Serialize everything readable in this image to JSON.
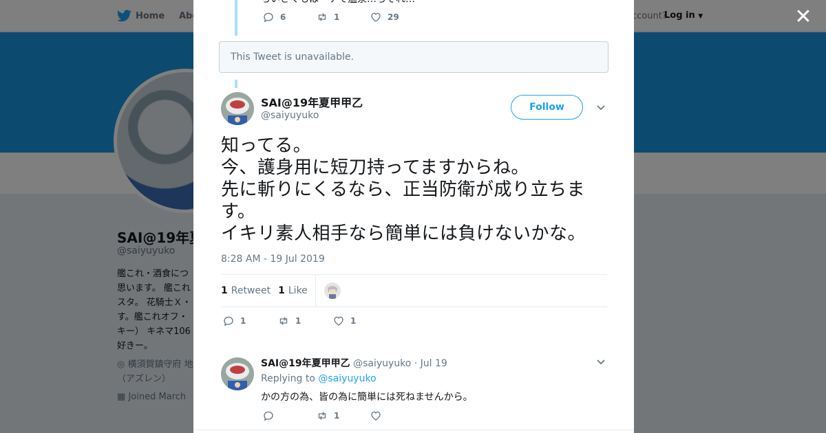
{
  "nav": {
    "home_label": "Home",
    "about_label": "Abo",
    "account_prompt": "ccount?",
    "login_label": "Log in"
  },
  "profile": {
    "name": "SAI@19年夏",
    "handle": "@saiyuyuko",
    "bio": "艦これ・酒食につ 思います。 艦これ スタ。 花騎士Ｘ・ す。艦これオフ・ キー） キネマ106 好きー。",
    "location": "横須賀鎮守府 地（アズレン）",
    "joined": "Joined March"
  },
  "modal": {
    "top_tweet": {
      "snippet_text": "ちいさくもはーケて温泉…ちそれ…",
      "reply_count": "6",
      "retweet_count": "1",
      "like_count": "29"
    },
    "unavailable_notice": "This Tweet is unavailable.",
    "main_tweet": {
      "name": "SAI@19年夏甲甲乙",
      "handle": "@saiyuyuko",
      "follow_label": "Follow",
      "lines": [
        "知ってる。",
        "今、護身用に短刀持ってますからね。",
        "先に斬りにくるなら、正当防衛が成り立ちま",
        "す。",
        "イキリ素人相手なら簡単には負けないかな。"
      ],
      "timestamp": "8:28 AM - 19 Jul 2019",
      "stats": {
        "retweets_num": "1",
        "retweets_label": "Retweet",
        "likes_num": "1",
        "likes_label": "Like"
      },
      "reply_count": "1",
      "retweet_count": "1",
      "like_count": "1"
    },
    "reply_tweet": {
      "name": "SAI@19年夏甲甲乙",
      "handle": "@saiyuyuko",
      "date": "· Jul 19",
      "replying_prefix": "Replying to",
      "replying_mention": "@saiyuyuko",
      "text": "かの方の為、皆の為に簡単には死ねませんから。",
      "reply_count": "",
      "retweet_count": "1",
      "like_count": ""
    }
  },
  "colors": {
    "brand_blue": "#1da1f2",
    "banner_blue": "#1b95e0",
    "secondary_text": "#657786",
    "thread_line": "#a9ddff"
  },
  "icons": [
    "twitter-bird-icon",
    "close-icon",
    "reply-icon",
    "retweet-icon",
    "like-icon",
    "chevron-down-icon",
    "location-icon",
    "calendar-icon"
  ]
}
